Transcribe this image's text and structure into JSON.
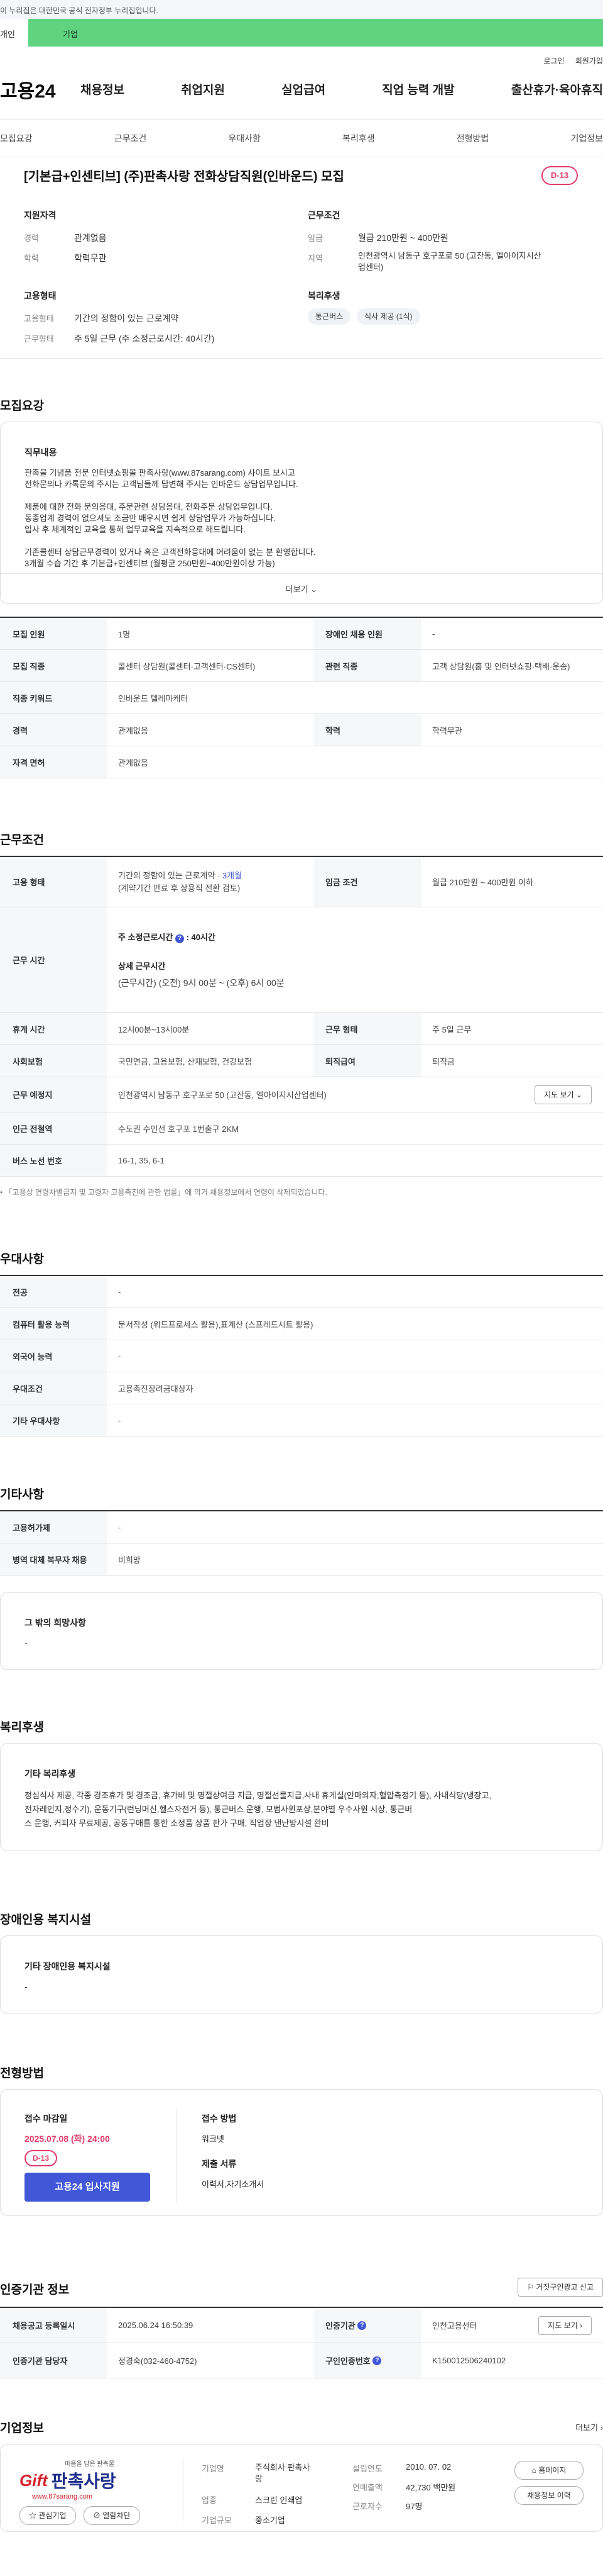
{
  "gov_banner": "이 누리집은 대한민국 공식 전자정부 누리집입니다.",
  "topbar": {
    "left_tab": "개인",
    "right_tab": "기업"
  },
  "utility": {
    "login": "로그인",
    "signup": "회원가입"
  },
  "site": {
    "logo": "고용24"
  },
  "gnb": [
    "채용정보",
    "취업지원",
    "실업급여",
    "직업 능력 개발",
    "출산휴가·육아휴직"
  ],
  "subnav": [
    "모집요강",
    "근무조건",
    "우대사항",
    "복리후생",
    "전형방법",
    "기업정보"
  ],
  "header": {
    "title": "[기본급+인센티브] (주)판촉사랑 전화상담직원(인바운드) 모집",
    "dday": "D-13",
    "qualification": {
      "heading": "지원자격",
      "career_label": "경력",
      "career": "관계없음",
      "education_label": "학력",
      "education": "학력무관"
    },
    "conditions": {
      "heading": "근무조건",
      "wage_label": "임금",
      "wage": "월급 210만원 ~ 400만원",
      "location_label": "지역",
      "location_line1": "인천광역시 남동구 호구포로 50 (고잔동, 엘아이지시산",
      "location_line2": "업센터)"
    },
    "employment": {
      "heading": "고용형태",
      "type_label": "고용형태",
      "type": "기간의 정함이 있는 근로계약",
      "hours_label": "근무형태",
      "hours": "주 5일 근무 (주 소정근로시간: 40시간)"
    },
    "welfare": {
      "heading": "복리후생",
      "chips": [
        "통근버스",
        "식사 제공 (1식)"
      ]
    }
  },
  "recruit": {
    "heading": "모집요강",
    "duty_heading": "직무내용",
    "duty_lines": [
      "판촉물 기념품 전문 인터넷쇼핑몰 판촉사랑(www.87sarang.com) 사이트 보시고",
      "전화문의나 카톡문의 주시는 고객님들께 답변해 주시는 인바운드 상담업무입니다.",
      "",
      "제품에 대한 전화 문의응대, 주문관련 상담응대, 전화주문 상담업무입니다.",
      "동종업계 경력이 없으셔도 조금만 배우시면 쉽게 상담업무가 가능하십니다.",
      "입사 후 체계적인 교육을 통해 업무교육을 지속적으로 해드립니다.",
      "",
      "기존콜센터 상담근무경력이 있거나 혹은 고객전화응대에 어려움이 없는 분 환영합니다.",
      "3개월 수습 기간 후 기본급+인센티브 (월평균 250만원~400만원이상 가능)"
    ],
    "more": "더보기",
    "rows": [
      {
        "l1": "모집 인원",
        "v1": "1명",
        "l2": "장애인 채용 인원",
        "v2": "-"
      },
      {
        "l1": "모집 직종",
        "v1": "콜센터 상담원(콜센터·고객센터·CS센터)",
        "l2": "관련 직종",
        "v2": "고객 상담원(홈 및 인터넷쇼핑·택배·운송)"
      },
      {
        "l1": "직종 키워드",
        "v1": "인바운드 텔레마케터"
      },
      {
        "l1": "경력",
        "v1": "관계없음",
        "l2": "학력",
        "v2": "학력무관"
      },
      {
        "l1": "자격 면허",
        "v1": "관계없음"
      }
    ]
  },
  "work": {
    "heading": "근무조건",
    "employment_label": "고용 형태",
    "employment_line1": "기간의 정함이 있는 근로계약 · ",
    "employment_months": "3개월",
    "employment_line2": "(계약기간 만료 후 상용직 전환 검토)",
    "wage_label": "임금 조건",
    "wage": "월급 210만원 ~ 400만원 이하",
    "time_label": "근무 시간",
    "weekly": "주 소정근로시간",
    "weekly_value": ": 40시간",
    "detail_heading": "상세 근무시간",
    "detail": "(근무시간) (오전) 9시 00분 ~ (오후) 6시 00분",
    "rest_label": "휴게 시간",
    "rest": "12시00분~13시00분",
    "form_label": "근무 형태",
    "form": "주 5일 근무",
    "insurance_label": "사회보험",
    "insurance": "국민연금, 고용보험, 산재보험, 건강보험",
    "severance_label": "퇴직급여",
    "severance": "퇴직금",
    "place_label": "근무 예정지",
    "place": "인천광역시 남동구 호구포로 50 (고잔동, 엘아이지시산업센터)",
    "map_btn": "지도 보기",
    "station_label": "인근 전철역",
    "station": "수도권 수인선 호구포 1번출구 2KM",
    "bus_label": "버스 노선 번호",
    "bus": "16-1, 35, 6-1",
    "note": "「고용상 연령차별금지 및 고령자 고용촉진에 관한 법률」에 의거 채용정보에서 연령이 삭제되었습니다."
  },
  "preference": {
    "heading": "우대사항",
    "rows": [
      {
        "l": "전공",
        "v": "-"
      },
      {
        "l": "컴퓨터 활용 능력",
        "v": "문서작성 (워드프로세스 활용),표계산 (스프레드시트 활용)"
      },
      {
        "l": "외국어 능력",
        "v": "-"
      },
      {
        "l": "우대조건",
        "v": "고용촉진장려금대상자"
      },
      {
        "l": "기타 우대사항",
        "v": "-"
      }
    ]
  },
  "other": {
    "heading": "기타사항",
    "rows": [
      {
        "l": "고용허가제",
        "v": "-"
      },
      {
        "l": "병역 대체 복무자 채용",
        "v": "비희망"
      }
    ],
    "hope_heading": "그 밖의 희망사항",
    "hope": "-"
  },
  "benefit": {
    "heading": "복리후생",
    "box_heading": "기타 복리후생",
    "lines": [
      "정심식사 제공, 각종 경조휴가 및 경조금, 휴가비 및 명절상여금 지급, 명절선물지급,사내 휴게실(안마의자,혈압측정기 등), 사내식당(냉장고,",
      "전자레인지,정수기), 운동기구(런닝머신,헬스자전거 등), 통근버스 운행, 모범사원포상,분야별 우수사원 시상, 통근버",
      "스 운행, 커피자 무료제공, 공동구매를 통한 소정품 상품 판가 구매, 직업장 낸난방시설 완비"
    ]
  },
  "disability": {
    "heading": "장애인용 복지시설",
    "box_heading": "기타 장애인용 복지시설",
    "value": "-"
  },
  "selection": {
    "heading": "전형방법",
    "deadline_heading": "접수 마감일",
    "deadline": "2025.07.08 (화) 24:00",
    "dday": "D-13",
    "apply_btn": "고용24 입사지원",
    "method_heading": "접수 방법",
    "method": "워크넷",
    "docs_heading": "제출 서류",
    "docs": "이력서,자기소개서"
  },
  "cert": {
    "heading": "인증기관 정보",
    "report_btn": "거짓구인광고 신고",
    "reg_date_label": "채용공고 등록일시",
    "reg_date": "2025.06.24 16:50:39",
    "agency_label": "인증기관",
    "agency": "인천고용센터",
    "map_btn": "지도 보기",
    "manager_label": "인증기관 담당자",
    "manager": "정경숙(032-460-4752)",
    "number_label": "구인인증번호",
    "number": "K150012506240102"
  },
  "company": {
    "heading": "기업정보",
    "more": "더보기",
    "logo_slogan": "마음을 담은 판촉물",
    "logo_name": "판촉사랑",
    "logo_url": "www.87sarang.com",
    "fav_btn": "관심기업",
    "block_btn": "열람차단",
    "name_label": "기업명",
    "name_line1": "주식회사 판촉사",
    "name_line2": "랑",
    "industry_label": "업종",
    "industry": "스크린 인쇄업",
    "scale_label": "기업규모",
    "scale": "중소기업",
    "founded_label": "설립연도",
    "founded": "2010. 07. 02",
    "sales_label": "연매출액",
    "sales": "42,730 백만원",
    "workers_label": "근로자수",
    "workers": "97명",
    "homepage_btn": "홈페이지",
    "jobs_btn": "채용정보 이력"
  },
  "colors": {
    "accent": "#e23b6b",
    "brand_green": "#5fd37f",
    "primary": "#4157d8"
  }
}
